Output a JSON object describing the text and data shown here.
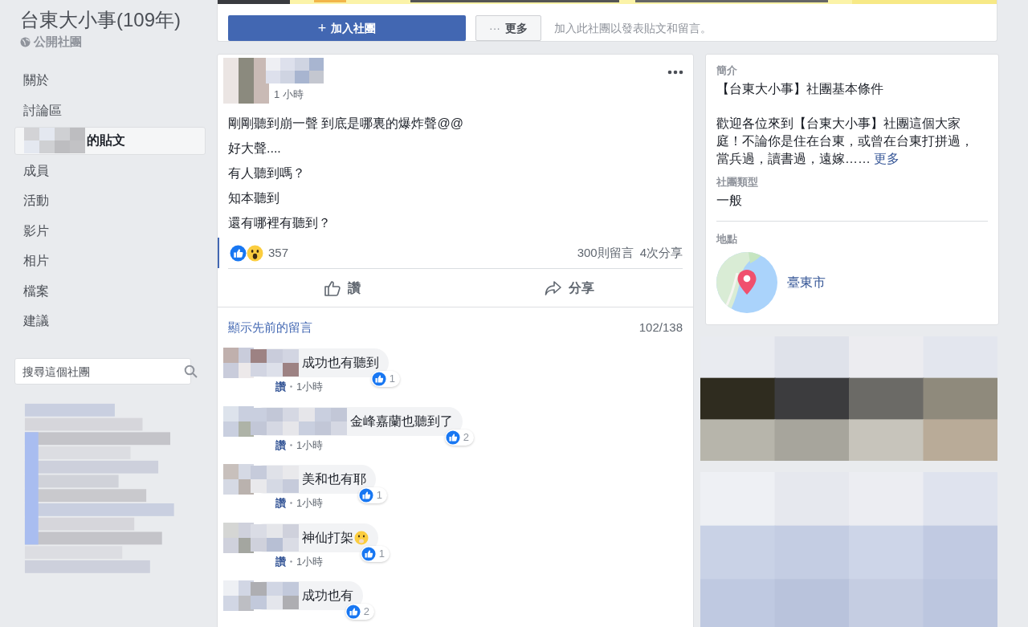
{
  "group": {
    "title": "台東大小事(109年)",
    "privacy": "公開社團"
  },
  "nav": [
    {
      "label": "關於",
      "selected": false,
      "kind": "plain"
    },
    {
      "label": "討論區",
      "selected": false,
      "kind": "plain"
    },
    {
      "label": "的貼文",
      "selected": true,
      "kind": "member_posts"
    },
    {
      "label": "成員",
      "selected": false,
      "kind": "plain"
    },
    {
      "label": "活動",
      "selected": false,
      "kind": "plain"
    },
    {
      "label": "影片",
      "selected": false,
      "kind": "plain"
    },
    {
      "label": "相片",
      "selected": false,
      "kind": "plain"
    },
    {
      "label": "檔案",
      "selected": false,
      "kind": "plain"
    },
    {
      "label": "建議",
      "selected": false,
      "kind": "plain"
    }
  ],
  "search": {
    "placeholder": "搜尋這個社團"
  },
  "header": {
    "join_icon": "+",
    "join": "加入社團",
    "more_icon": "···",
    "more": "更多",
    "hint": "加入此社團以發表貼文和留言。"
  },
  "post": {
    "time": "1 小時",
    "lines": [
      "剛剛聽到崩一聲 到底是哪裏的爆炸聲@@",
      "好大聲....",
      "有人聽到嗎？",
      "知本聽到",
      "還有哪裡有聽到？"
    ],
    "reaction_count": "357",
    "comment_count": "300則留言",
    "share_count": "4次分享",
    "actions": [
      "讚",
      "分享"
    ],
    "previous_comments": "顯示先前的留言",
    "comment_page": "102/138",
    "comments": [
      {
        "text": "成功也有聽到",
        "emoji": false,
        "likes": "1",
        "like": "讚",
        "time": "1小時"
      },
      {
        "text": "金峰嘉蘭也聽到了",
        "emoji": false,
        "likes": "2",
        "like": "讚",
        "time": "1小時"
      },
      {
        "text": "美和也有耶",
        "emoji": false,
        "likes": "1",
        "like": "讚",
        "time": "1小時"
      },
      {
        "text": "神仙打架",
        "emoji": true,
        "likes": "1",
        "like": "讚",
        "time": "1小時"
      },
      {
        "text": "成功也有",
        "emoji": false,
        "likes": "2"
      }
    ]
  },
  "about": {
    "heading": "簡介",
    "title": "【台東大小事】社團基本條件",
    "description": "歡迎各位來到【台東大小事】社團這個大家庭！不論你是住在台東，或曾在台東打拼過，當兵過，讀書過，遠嫁……",
    "more": "更多",
    "type_label": "社團類型",
    "type_value": "一般",
    "location_label": "地點",
    "location": "臺東市"
  }
}
